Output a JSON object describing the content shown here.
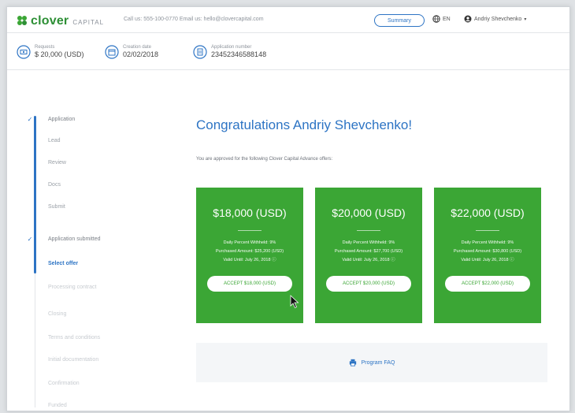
{
  "header": {
    "logo_main": "clover",
    "logo_sub": "CAPITAL",
    "contact": "Call us: 555-100-0770   Email us: hello@clovercapital.com",
    "summary_button": "Summary",
    "language": "EN",
    "user_name": "Andriy Shevchenko"
  },
  "info": [
    {
      "label": "Requests",
      "value": "$ 20,000 (USD)"
    },
    {
      "label": "Creation date",
      "value": "02/02/2018"
    },
    {
      "label": "Application number",
      "value": "23452346588148"
    }
  ],
  "steps": [
    {
      "label": "Application",
      "state": "done"
    },
    {
      "label": "Lead",
      "state": "sub"
    },
    {
      "label": "Review",
      "state": "sub"
    },
    {
      "label": "Docs",
      "state": "sub"
    },
    {
      "label": "Submit",
      "state": "sub"
    },
    {
      "label": "Application submitted",
      "state": "done"
    },
    {
      "label": "Select offer",
      "state": "active"
    },
    {
      "label": "Processing contract",
      "state": "pending"
    },
    {
      "label": "Closing",
      "state": "pending"
    },
    {
      "label": "Terms and conditions",
      "state": "pending"
    },
    {
      "label": "Initial documentation",
      "state": "pending"
    },
    {
      "label": "Confirmation",
      "state": "pending"
    },
    {
      "label": "Funded",
      "state": "pending"
    }
  ],
  "main": {
    "title": "Congratulations Andriy Shevchenko!",
    "subtitle": "You are approved for the following Clover Capital Advance offers:",
    "print_label": "Program FAQ"
  },
  "offers": [
    {
      "amount": "$18,000 (USD)",
      "line1": "Daily Percent Withheld: 9%",
      "line2": "Purchased Amount: $25,200 (USD)",
      "line3": "Valid Until: July 26, 2018",
      "button": "ACCEPT $18,000 (USD)"
    },
    {
      "amount": "$20,000 (USD)",
      "line1": "Daily Percent Withheld: 9%",
      "line2": "Purchased Amount: $27,700 (USD)",
      "line3": "Valid Until: July 26, 2018",
      "button": "ACCEPT $20,000 (USD)"
    },
    {
      "amount": "$22,000 (USD)",
      "line1": "Daily Percent Withheld: 9%",
      "line2": "Purchased Amount: $30,800 (USD)",
      "line3": "Valid Until: July 26, 2018",
      "button": "ACCEPT $22,000 (USD)"
    }
  ],
  "colors": {
    "brand_green": "#3ba635",
    "logo_green": "#2d8f35",
    "accent_blue": "#2d74c4"
  }
}
